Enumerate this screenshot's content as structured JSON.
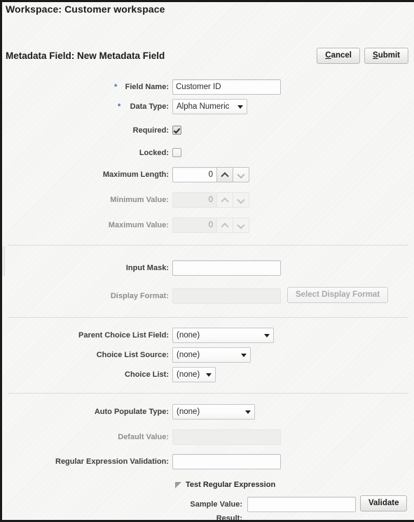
{
  "header": {
    "workspace_title": "Workspace: Customer workspace",
    "form_title": "Metadata Field: New Metadata Field",
    "cancel_accesskey": "C",
    "cancel_rest": "ancel",
    "submit_accesskey": "S",
    "submit_rest": "ubmit"
  },
  "section_basic": {
    "field_name": {
      "label": "Field Name:",
      "value": "Customer ID",
      "required_marker": "*"
    },
    "data_type": {
      "label": "Data Type:",
      "value": "Alpha Numeric",
      "required_marker": "*"
    },
    "required": {
      "label": "Required:",
      "checked": true
    },
    "locked": {
      "label": "Locked:",
      "checked": false
    },
    "maximum_length": {
      "label": "Maximum Length:",
      "value": "0"
    },
    "minimum_value": {
      "label": "Minimum Value:",
      "value": "0"
    },
    "maximum_value": {
      "label": "Maximum Value:",
      "value": "0"
    }
  },
  "section_format": {
    "input_mask": {
      "label": "Input Mask:",
      "value": ""
    },
    "display_format": {
      "label": "Display Format:",
      "value": ""
    },
    "select_display_format_button": "Select Display Format"
  },
  "section_choice": {
    "parent_choice_list_field": {
      "label": "Parent Choice List Field:",
      "value": "(none)"
    },
    "choice_list_source": {
      "label": "Choice List Source:",
      "value": "(none)"
    },
    "choice_list": {
      "label": "Choice List:",
      "value": "(none)"
    }
  },
  "section_auto": {
    "auto_populate_type": {
      "label": "Auto Populate Type:",
      "value": "(none)"
    },
    "default_value": {
      "label": "Default Value:",
      "value": ""
    },
    "regular_expression_validation": {
      "label": "Regular Expression Validation:",
      "value": ""
    },
    "test_regex": {
      "disclosure_label": "Test Regular Expression",
      "sample_value_label": "Sample Value:",
      "sample_value": "",
      "validate_button": "Validate",
      "result_label": "Result:",
      "result_value": ""
    }
  }
}
